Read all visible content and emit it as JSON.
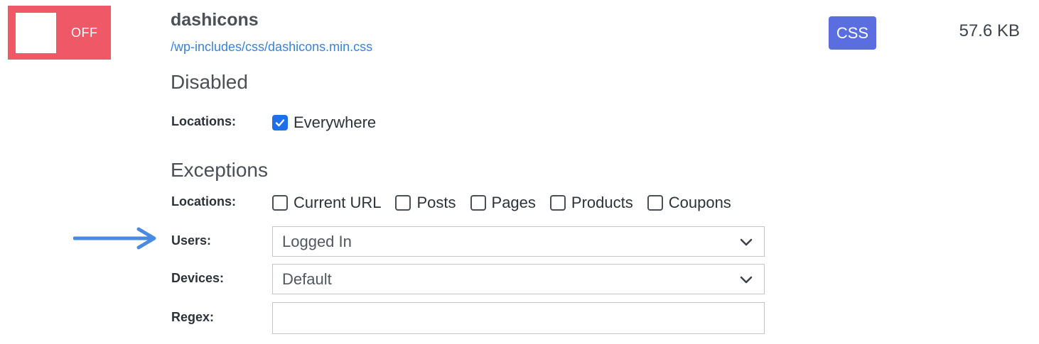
{
  "toggle": {
    "label": "OFF",
    "state": "off",
    "color": "#ef5866"
  },
  "asset": {
    "name": "dashicons",
    "path": "/wp-includes/css/dashicons.min.css",
    "type": "CSS",
    "size": "57.6 KB"
  },
  "disabled": {
    "heading": "Disabled",
    "locations_label": "Locations:",
    "everywhere_label": "Everywhere",
    "everywhere_checked": true
  },
  "exceptions": {
    "heading": "Exceptions",
    "locations_label": "Locations:",
    "locations": [
      {
        "label": "Current URL",
        "checked": false
      },
      {
        "label": "Posts",
        "checked": false
      },
      {
        "label": "Pages",
        "checked": false
      },
      {
        "label": "Products",
        "checked": false
      },
      {
        "label": "Coupons",
        "checked": false
      }
    ],
    "users_label": "Users:",
    "users_value": "Logged In",
    "devices_label": "Devices:",
    "devices_value": "Default",
    "regex_label": "Regex:",
    "regex_value": ""
  },
  "icons": {
    "arrow": "right-arrow-icon",
    "checkmark": "checkmark-icon",
    "chevron": "chevron-down-icon"
  },
  "colors": {
    "accent": "#1f6fe8",
    "badge": "#5a6ee0",
    "link": "#3b82d6",
    "arrow": "#4a8ae0"
  }
}
